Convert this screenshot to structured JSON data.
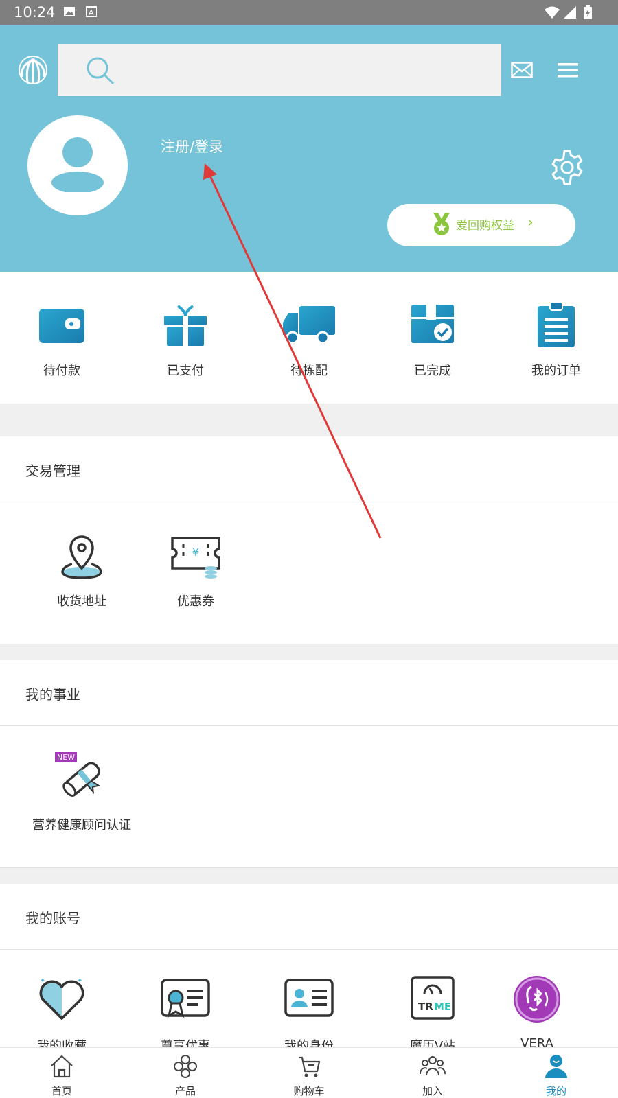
{
  "status_bar": {
    "time": "10:24"
  },
  "header": {
    "search_placeholder": "",
    "login_text": "注册/登录",
    "benefit_label": "爱回购权益",
    "benefit_chevron": "›"
  },
  "orders": [
    {
      "label": "待付款",
      "icon": "wallet-icon"
    },
    {
      "label": "已支付",
      "icon": "gift-icon"
    },
    {
      "label": "待拣配",
      "icon": "truck-icon"
    },
    {
      "label": "已完成",
      "icon": "box-check-icon"
    },
    {
      "label": "我的订单",
      "icon": "clipboard-icon"
    }
  ],
  "sections": {
    "trade": {
      "title": "交易管理",
      "items": [
        {
          "label": "收货地址",
          "icon": "location-pin-icon"
        },
        {
          "label": "优惠券",
          "icon": "coupon-icon"
        }
      ]
    },
    "career": {
      "title": "我的事业",
      "items": [
        {
          "label": "营养健康顾问认证",
          "icon": "certificate-icon",
          "badge": "NEW"
        }
      ]
    },
    "account": {
      "title": "我的账号",
      "items": [
        {
          "label": "我的收藏",
          "icon": "heart-icon"
        },
        {
          "label": "尊享优惠",
          "icon": "vip-card-icon"
        },
        {
          "label": "我的身份",
          "icon": "id-card-icon"
        },
        {
          "label": "魔历V站",
          "icon": "trme-icon"
        },
        {
          "label": "VERA",
          "icon": "vera-icon"
        }
      ]
    }
  },
  "bottom_nav": [
    {
      "label": "首页",
      "icon": "home-icon"
    },
    {
      "label": "产品",
      "icon": "product-icon"
    },
    {
      "label": "购物车",
      "icon": "cart-icon"
    },
    {
      "label": "加入",
      "icon": "join-icon"
    },
    {
      "label": "我的",
      "icon": "profile-icon",
      "active": true
    }
  ],
  "colors": {
    "header_bg": "#75c3d8",
    "accent_green": "#8cc63f",
    "icon_blue": "#1f8fbf",
    "nav_active": "#1a8fbf",
    "annotation_arrow": "#e0393a"
  }
}
